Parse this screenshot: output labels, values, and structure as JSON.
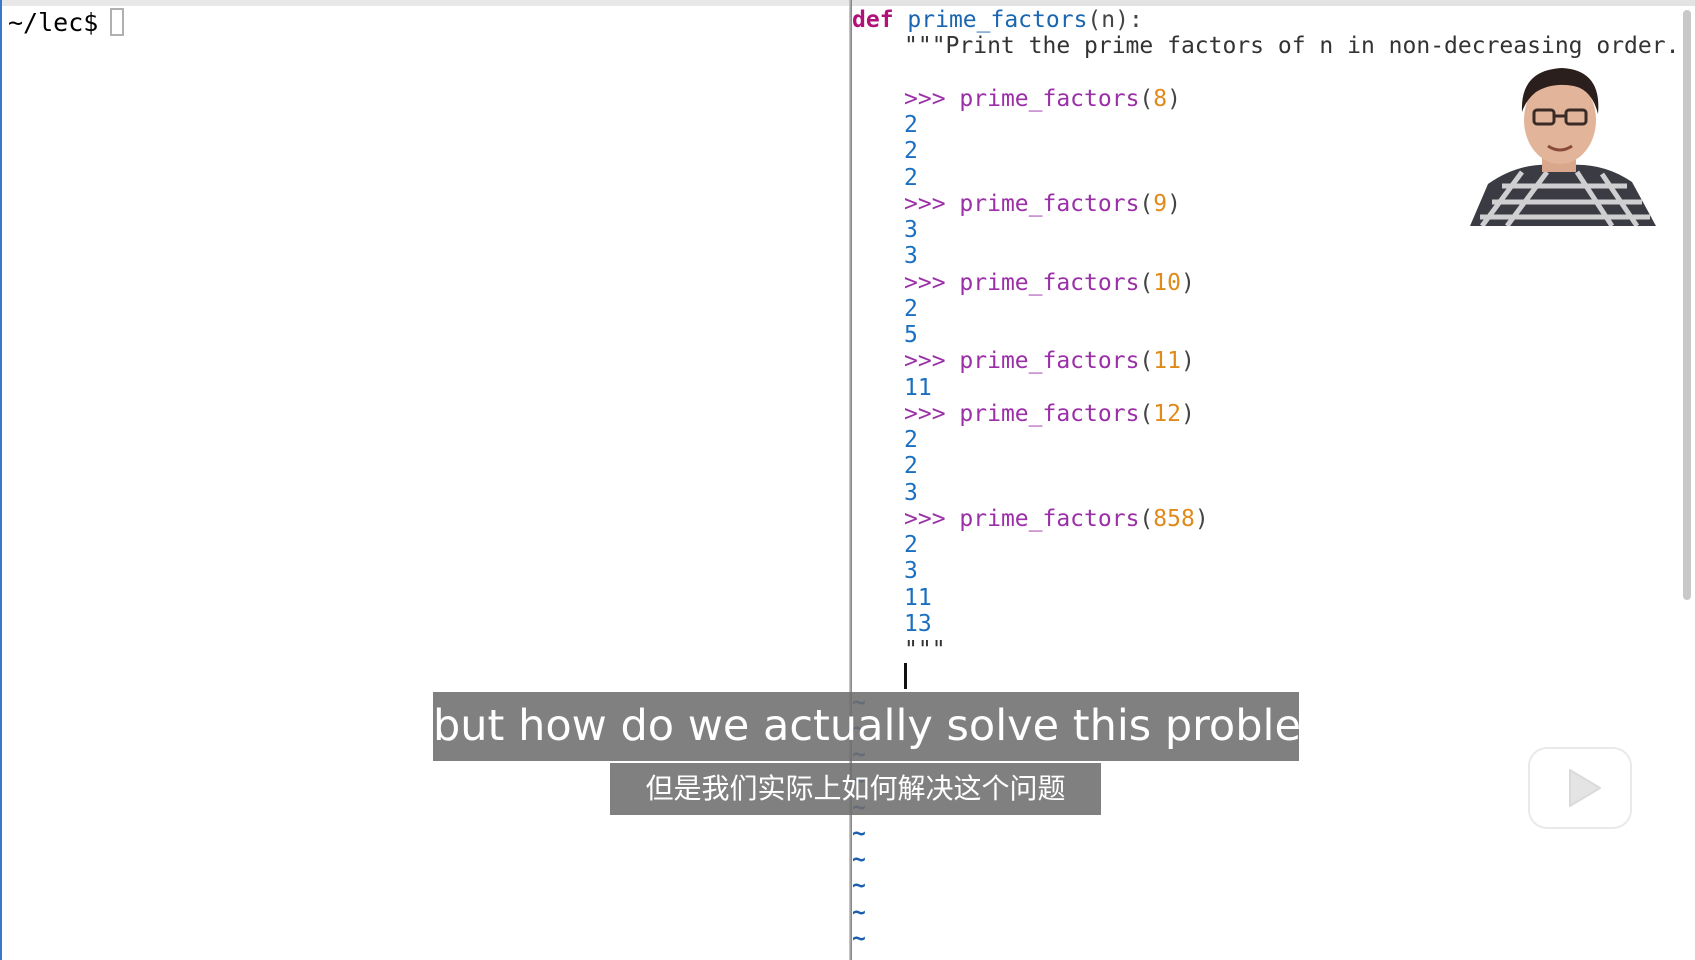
{
  "terminal": {
    "prompt": "~/lec$"
  },
  "editor": {
    "def_keyword": "def",
    "def_name": "prime_factors",
    "def_sig": "(n):",
    "docstring_open": "\"\"\"Print the prime factors of n in non-decreasing order.",
    "examples": [
      {
        "prompt": ">>>",
        "call": "prime_factors",
        "arg": "8",
        "outputs": [
          "2",
          "2",
          "2"
        ]
      },
      {
        "prompt": ">>>",
        "call": "prime_factors",
        "arg": "9",
        "outputs": [
          "3",
          "3"
        ]
      },
      {
        "prompt": ">>>",
        "call": "prime_factors",
        "arg": "10",
        "outputs": [
          "2",
          "5"
        ]
      },
      {
        "prompt": ">>>",
        "call": "prime_factors",
        "arg": "11",
        "outputs": [
          "11"
        ]
      },
      {
        "prompt": ">>>",
        "call": "prime_factors",
        "arg": "12",
        "outputs": [
          "2",
          "2",
          "3"
        ]
      },
      {
        "prompt": ">>>",
        "call": "prime_factors",
        "arg": "858",
        "outputs": [
          "2",
          "3",
          "11",
          "13"
        ]
      }
    ],
    "docstring_close": "\"\"\"",
    "empty_line_marker": "~"
  },
  "subtitles": {
    "english": "but how do we actually solve this problem",
    "chinese": "但是我们实际上如何解决这个问题"
  },
  "colors": {
    "keyword": "#b0127a",
    "function_name": "#1a66b0",
    "doctest_prompt": "#9b2fa8",
    "argument_number": "#e08a1a",
    "output_number": "#1a6fc0",
    "tilde": "#1a5fb0",
    "subtitle_bg": "#6e6e6e"
  },
  "icons": {
    "play": "play-icon",
    "webcam": "presenter-webcam"
  }
}
